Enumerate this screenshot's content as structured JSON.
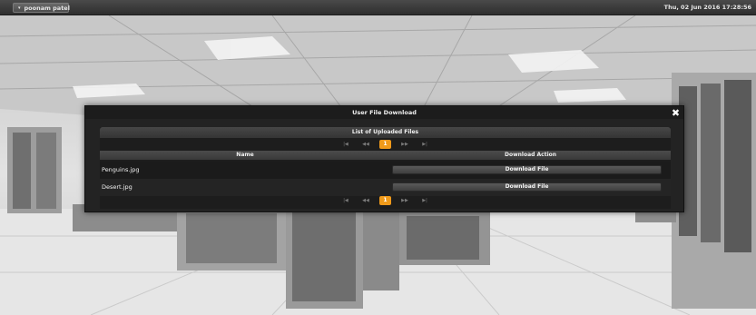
{
  "topbar": {
    "user_menu_caret": "▾",
    "user_name": "poonam patel",
    "datetime": "Thu, 02 Jun 2016 17:28:56"
  },
  "dialog": {
    "title": "User File Download",
    "close_glyph": "✖",
    "panel_title": "List of Uploaded Files",
    "pager": {
      "first": "|◀",
      "prev": "◀◀",
      "current": "1",
      "next": "▶▶",
      "last": "▶|"
    },
    "columns": {
      "name": "Name",
      "action": "Download Action"
    },
    "rows": [
      {
        "name": "Penguins.jpg",
        "action_label": "Download File"
      },
      {
        "name": "Desert.jpg",
        "action_label": "Download File"
      }
    ]
  },
  "colors": {
    "accent": "#f09a1a",
    "dialog_bg": "#232323",
    "topbar_bg": "#2e2e2e"
  }
}
